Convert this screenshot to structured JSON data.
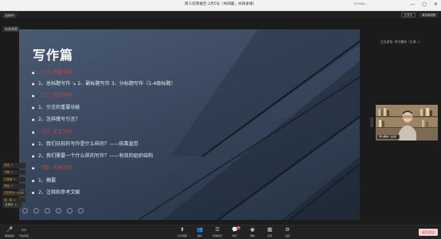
{
  "window": {
    "title": "周三双周报告-2月5号（共四集，共四讲课）",
    "clock": "07:54:0…",
    "window_buttons": [
      "—",
      "▢",
      "✕"
    ]
  },
  "topbar": {
    "tag": "说明中",
    "tag2": "标准视图",
    "record_label": "记录中",
    "layout_label": "演讲者视图"
  },
  "slide": {
    "title": "写作篇",
    "lines": [
      {
        "text": "（一）标题写作",
        "red": true,
        "bullet": false
      },
      {
        "text": "1、总标题写作  ↘   2、副标题写作       3、分标题写作（1-4级标题）",
        "red": false,
        "bullet": true
      },
      {
        "text": "（二）引言写作",
        "red": true,
        "bullet": false
      },
      {
        "text": "1、引言的重要功能",
        "red": false,
        "bullet": true
      },
      {
        "text": "2、怎样撰写引言？",
        "red": false,
        "bullet": true
      },
      {
        "text": "（三）正文写作",
        "red": true,
        "bullet": false
      },
      {
        "text": "1、我们日前的写作是什么样的？——依靠直觉",
        "red": false,
        "bullet": true
      },
      {
        "text": "2、我们需要一个什么样的写作？——有效的组织结构",
        "red": false,
        "bullet": true
      },
      {
        "text": "（四）其他写作",
        "red": true,
        "bullet": false
      },
      {
        "text": "1、摘要",
        "red": false,
        "bullet": true
      },
      {
        "text": "2、注释和参考文献",
        "red": false,
        "bullet": true
      }
    ]
  },
  "side_badges": [
    "完成: 1",
    "下载: 1",
    "已签到: 1",
    "参会: 1",
    "打扣时长: 0分钟",
    "回…答: 1"
  ],
  "share_label": "共享中（…",
  "speaker": {
    "label": "正在讲话: 李大教授（主讲…）",
    "video_name": "李大教授（主讲）"
  },
  "toolbar": {
    "left": [
      {
        "icon": "mic-icon",
        "glyph": "🎤",
        "label": "解除静音"
      },
      {
        "icon": "camera-icon",
        "glyph": "▭",
        "label": "开启视频"
      }
    ],
    "center": [
      {
        "icon": "share-screen-icon",
        "glyph": "⬆",
        "label": "共享屏幕"
      },
      {
        "icon": "participants-icon",
        "glyph": "👥",
        "label": "邀请"
      },
      {
        "icon": "manage-icon",
        "glyph": "☰",
        "label": "管理成员"
      },
      {
        "icon": "chat-icon",
        "glyph": "💬",
        "label": "聊天"
      },
      {
        "icon": "record-icon",
        "glyph": "◉",
        "label": "录制"
      },
      {
        "icon": "apps-icon",
        "glyph": "▦",
        "label": "应用"
      },
      {
        "icon": "settings-icon",
        "glyph": "⚙",
        "label": "设置"
      }
    ],
    "chat_count": "1",
    "end_label": "离开会议"
  }
}
